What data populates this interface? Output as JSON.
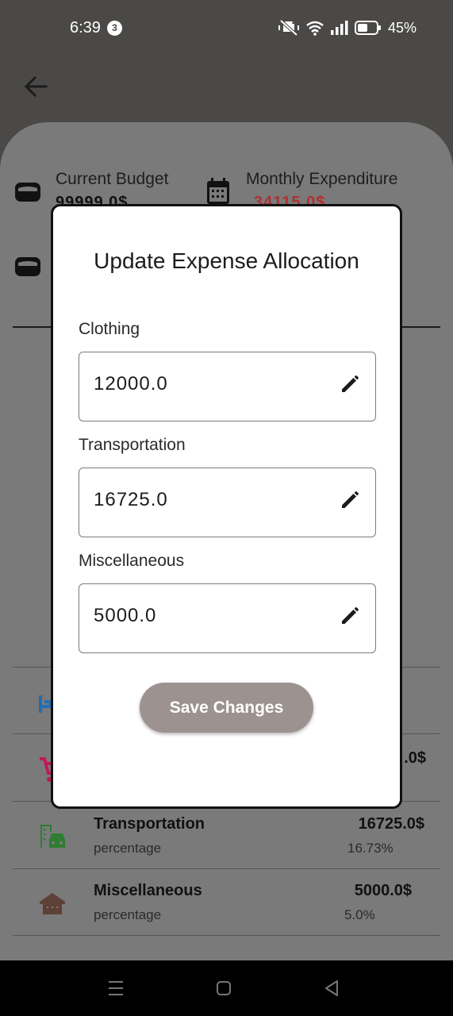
{
  "status_bar": {
    "time": "6:39",
    "notification_count": "3",
    "battery": "45%",
    "icons": [
      "mute-vibrate-icon",
      "wifi-icon",
      "signal-icon",
      "battery-icon"
    ]
  },
  "summary": {
    "current_budget_label": "Current Budget",
    "current_budget_value": "99999.0$",
    "monthly_expenditure_label": "Monthly Expenditure",
    "monthly_expenditure_value": "34115.0$"
  },
  "colors": {
    "expenditure": "#b03030",
    "save_button": "#9c9391"
  },
  "rows": [
    {
      "title": "Transportation",
      "subtitle": "percentage",
      "amount": "16725.0$",
      "percent": "16.73%",
      "icon": "transport-icon"
    },
    {
      "title": "Miscellaneous",
      "subtitle": "percentage",
      "amount": "5000.0$",
      "percent": "5.0%",
      "icon": "house-icon"
    }
  ],
  "partial_amount": ".0$",
  "dialog": {
    "title": "Update Expense Allocation",
    "fields": [
      {
        "label": "Clothing",
        "value": "12000.0"
      },
      {
        "label": "Transportation",
        "value": "16725.0"
      },
      {
        "label": "Miscellaneous",
        "value": "5000.0"
      }
    ],
    "save_label": "Save Changes"
  }
}
